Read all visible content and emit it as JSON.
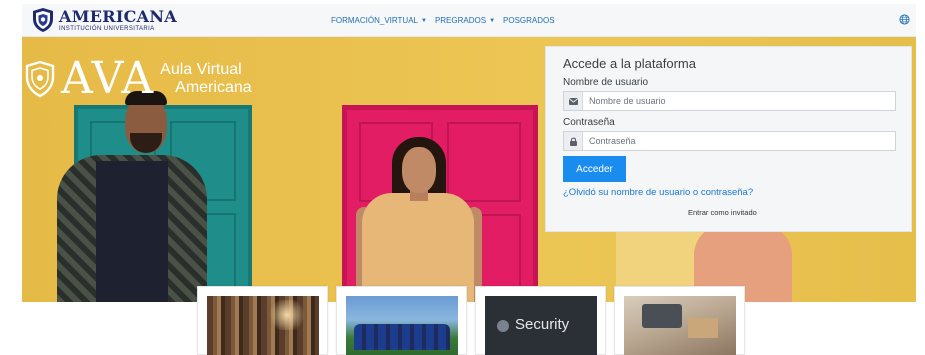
{
  "brand": {
    "name": "AMERICANA",
    "subtitle": "INSTITUCIÓN UNIVERSITARIA"
  },
  "nav": {
    "items": [
      {
        "label": "FORMACIÓN_VIRTUAL",
        "has_dropdown": true
      },
      {
        "label": "PREGRADOS",
        "has_dropdown": true
      },
      {
        "label": "POSGRADOS",
        "has_dropdown": false
      }
    ],
    "language_icon": "globe-icon"
  },
  "hero": {
    "logo_text": "AVA",
    "logo_line1": "Aula Virtual",
    "logo_line2": "Americana"
  },
  "login": {
    "title": "Accede a la plataforma",
    "username_label": "Nombre de usuario",
    "username_placeholder": "Nombre de usuario",
    "password_label": "Contraseña",
    "password_placeholder": "Contraseña",
    "submit_label": "Acceder",
    "forgot_link": "¿Olvidó su nombre de usuario o contraseña?",
    "guest_link": "Entrar como invitado"
  },
  "courses": {
    "security_text": "Security"
  },
  "colors": {
    "brand_navy": "#1f2a6e",
    "nav_link": "#1f6fb8",
    "primary_button": "#1a8cf0",
    "hero_yellow": "#e6bf48"
  }
}
